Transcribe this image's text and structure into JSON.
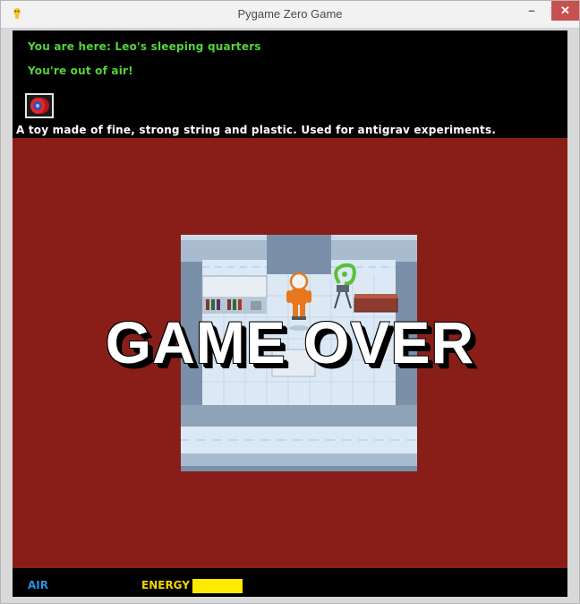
{
  "window": {
    "title": "Pygame Zero Game",
    "minimize_glyph": "–",
    "maximize_glyph": "□",
    "close_glyph": "✕"
  },
  "messages": {
    "location": "You are here: Leo's sleeping quarters",
    "air_warning": "You're out of air!",
    "item_description": "A toy made of fine, strong string and plastic. Used for antigrav experiments."
  },
  "selected_item": {
    "icon": "yoyo-icon"
  },
  "overlay": {
    "game_over": "GAME OVER"
  },
  "status": {
    "air_label": "AIR",
    "energy_label": "ENERGY",
    "air_level": 0,
    "energy_level": 1.0
  },
  "colors": {
    "play_background": "#891e19",
    "message_green": "#55d23c",
    "air_blue": "#2e8fe0",
    "energy_yellow": "#ffea00"
  }
}
